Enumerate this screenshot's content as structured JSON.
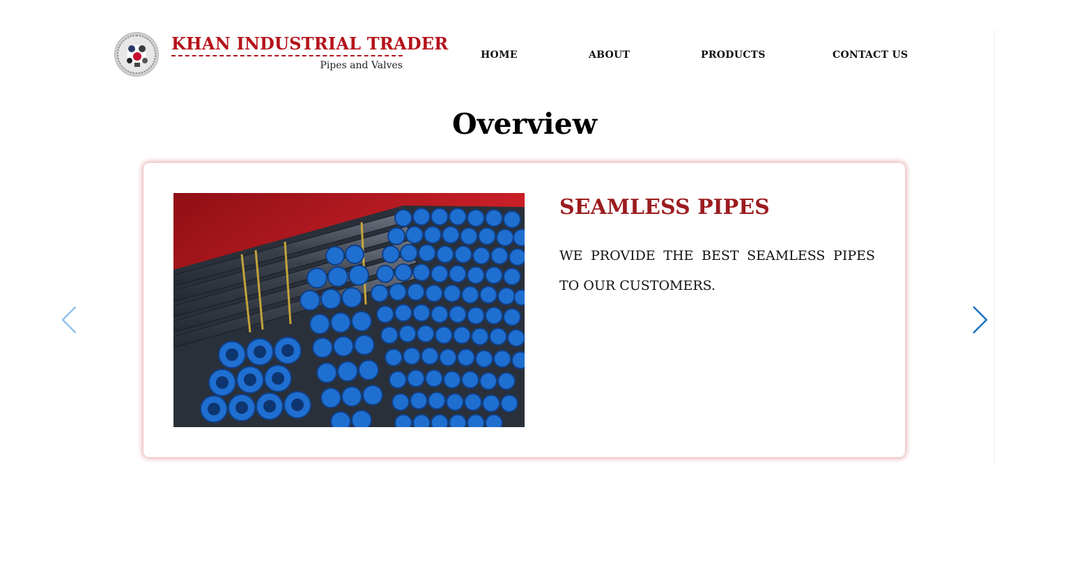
{
  "brand": {
    "name": "KHAN INDUSTRIAL TRADER",
    "tagline": "Pipes and Valves",
    "accent_color": "#b5121b"
  },
  "nav": {
    "items": [
      {
        "label": "HOME"
      },
      {
        "label": "ABOUT"
      },
      {
        "label": "PRODUCTS"
      },
      {
        "label": "CONTACT US"
      }
    ]
  },
  "overview": {
    "title": "Overview"
  },
  "carousel": {
    "slide": {
      "image_icon": "stacked-blue-capped-steel-pipes-photo",
      "title": "SEAMLESS PIPES",
      "description": "WE PROVIDE THE BEST SEAMLESS PIPES TO OUR CUSTOMERS.",
      "title_color": "#9b1c1f"
    },
    "prev_icon": "chevron-left-icon",
    "next_icon": "chevron-right-icon",
    "arrow_color": "#1a73c9"
  }
}
